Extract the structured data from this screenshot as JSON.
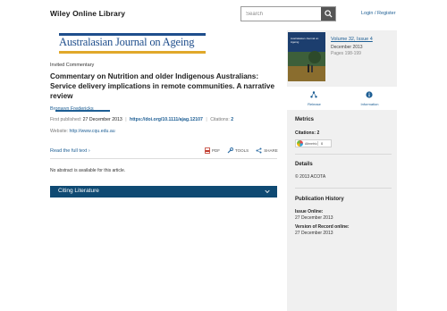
{
  "header": {
    "brand": "Wiley Online Library",
    "search_placeholder": "Search",
    "login_label": "Login / Register"
  },
  "journal": {
    "name": "Australasian Journal on Ageing"
  },
  "article": {
    "type": "Invited Commentary",
    "title": "Commentary on Nutrition and older Indigenous Australians: Service delivery implications in remote communities. A narrative review",
    "author": "Bronwyn Fredericks",
    "first_published_label": "First published:",
    "first_published_value": "27 December 2013",
    "doi": "https://doi.org/10.1111/ajag.12107",
    "citations_label": "Citations:",
    "citations_value": "2",
    "website_label": "Website:",
    "website_value": "http://www.cqu.edu.au",
    "read_full_label": "Read the full text",
    "pdf_label": "PDF",
    "tools_label": "TOOLS",
    "share_label": "SHARE",
    "abstract_note": "No abstract is available for this article."
  },
  "citing": {
    "label": "Citing Literature"
  },
  "sidebar": {
    "cover_text": "Australasian Journal on Ageing",
    "volume_issue": "Volume 32, Issue 4",
    "issue_date": "December 2013",
    "pages": "Pages 198-199",
    "tab_release": "Release",
    "tab_info": "Information",
    "metrics_heading": "Metrics",
    "citations_text": "Citations: 2",
    "altmetric_label": "Altmetric",
    "altmetric_count": "0",
    "details_heading": "Details",
    "copyright": "© 2013 ACOTA",
    "pub_history_heading": "Publication History",
    "issue_online_label": "Issue Online:",
    "issue_online_date": "27 December 2013",
    "vor_label": "Version of Record online:",
    "vor_date": "27 December 2013"
  },
  "colors": {
    "link": "#1d5e94",
    "citing_bar": "#0f4a73",
    "journal_blue": "#1f4e8c",
    "journal_gold": "#e0a82a",
    "sidebar_bg": "#f0f0f0"
  }
}
